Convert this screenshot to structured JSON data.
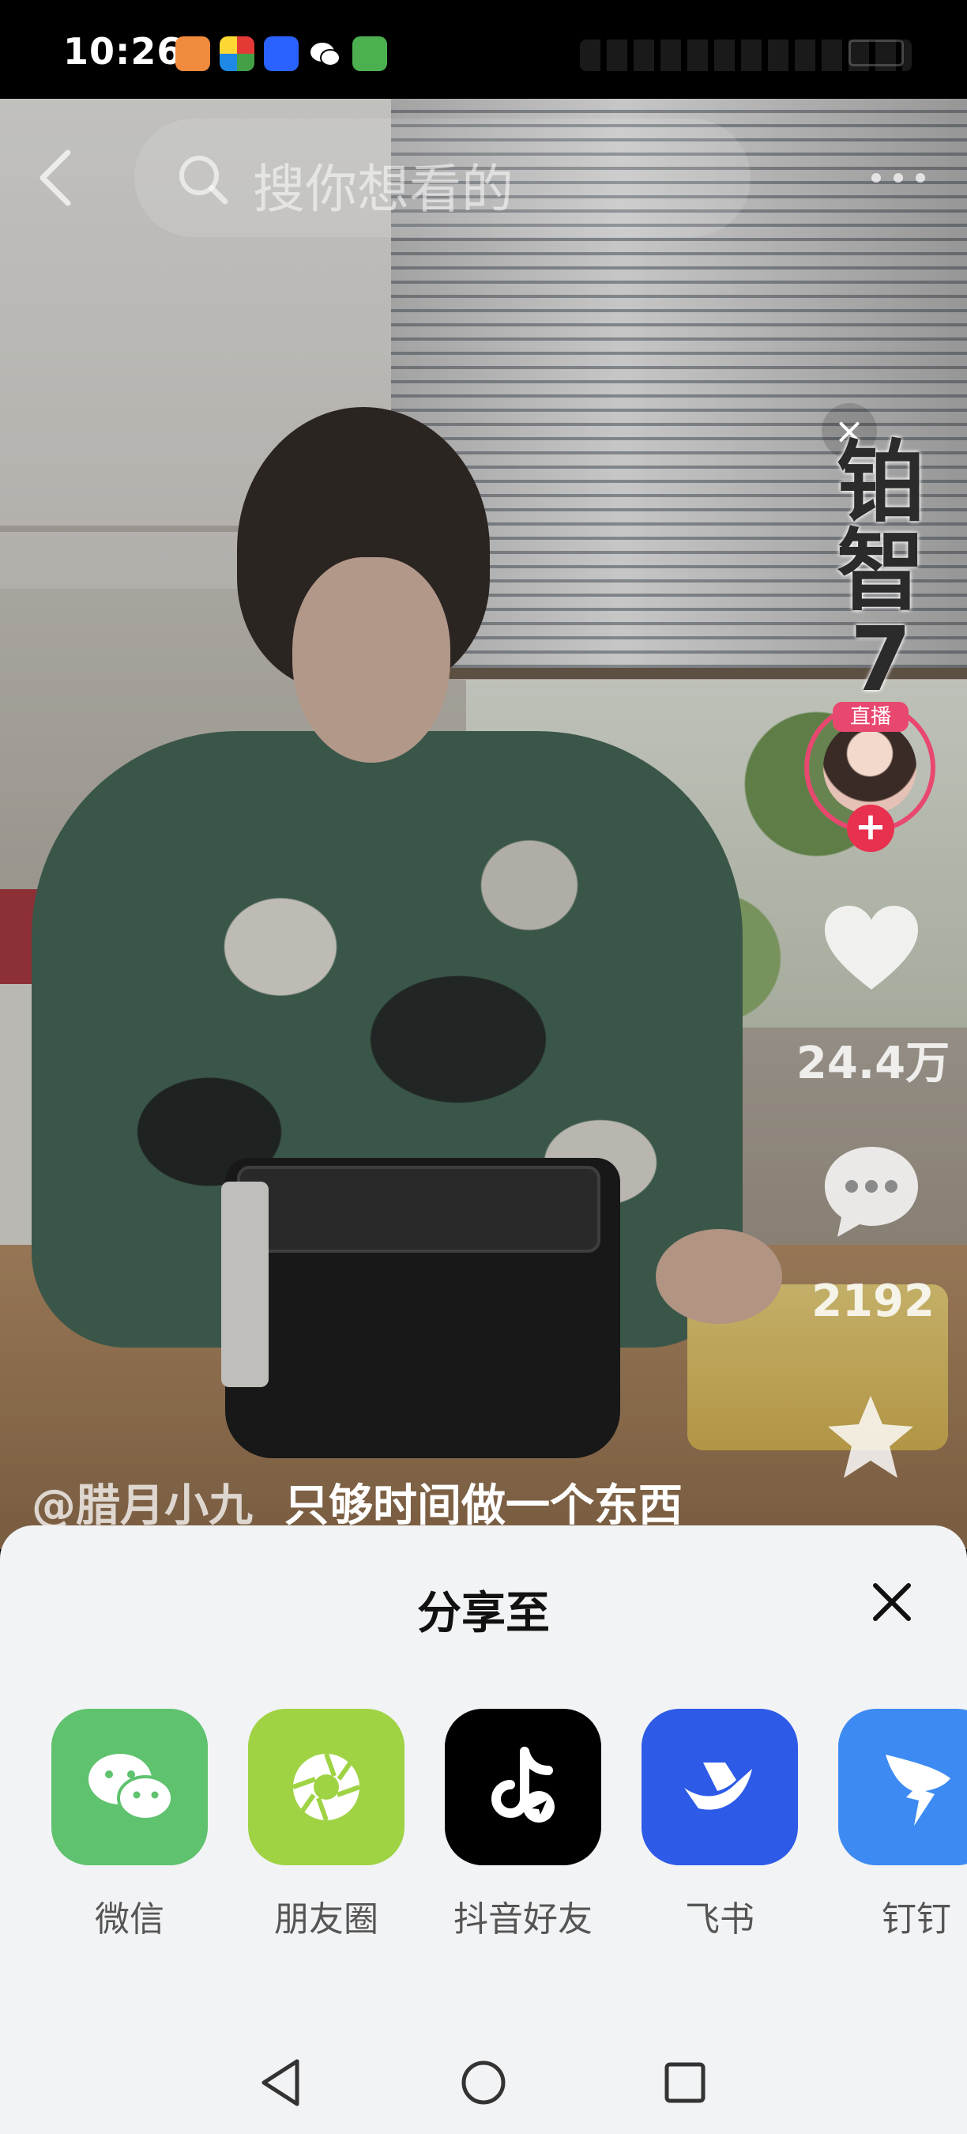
{
  "status_bar": {
    "time": "10:26"
  },
  "top_bar": {
    "search_placeholder": "搜你想看的"
  },
  "video": {
    "promo_text": "铂智7",
    "live_badge": "直播",
    "likes": "24.4万",
    "comments": "2192",
    "author": "@腊月小九",
    "subtitle": "只够时间做一个东西"
  },
  "share_sheet": {
    "title": "分享至",
    "targets": [
      {
        "label": "微信",
        "color": "#5fc26e",
        "icon": "wechat-icon"
      },
      {
        "label": "朋友圈",
        "color": "#9fd344",
        "icon": "moments-icon"
      },
      {
        "label": "抖音好友",
        "color": "#000000",
        "icon": "douyin-icon"
      },
      {
        "label": "飞书",
        "color": "#2d5ae6",
        "icon": "feishu-icon"
      },
      {
        "label": "钉钉",
        "color": "#3d8bf2",
        "icon": "dingtalk-icon"
      }
    ]
  },
  "colors": {
    "live_accent": "#e8486f",
    "sheet_background": "#f2f3f5"
  }
}
